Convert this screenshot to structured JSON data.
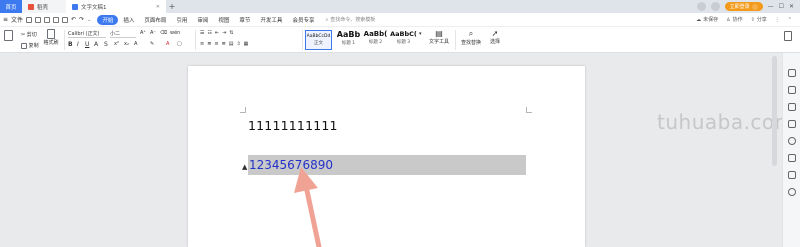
{
  "tabs": [
    {
      "label": "首页"
    },
    {
      "label": "稻壳"
    },
    {
      "label": "文字文稿1"
    }
  ],
  "tabbar_right": {
    "login": "立即登录"
  },
  "menubar": {
    "file": "文件",
    "items": [
      "开始",
      "插入",
      "页面布局",
      "引用",
      "审阅",
      "视图",
      "章节",
      "开发工具",
      "会员专享"
    ],
    "search_placeholder": "查找命令、搜索模板",
    "right": [
      "未保存",
      "协作",
      "分享"
    ]
  },
  "ribbon": {
    "cut": "剪切",
    "copy": "复制",
    "format_painter": "格式刷",
    "font_name": "Calibri (正文)",
    "font_size": "小二",
    "styles": [
      {
        "sample": "AaBbCcDd",
        "caption": "正文"
      },
      {
        "sample": "AaBb",
        "caption": "标题 1"
      },
      {
        "sample": "AaBb(",
        "caption": "标题 2"
      },
      {
        "sample": "AaBbC(",
        "caption": "标题 3"
      }
    ],
    "text_tool": "文字工具",
    "find_replace": "查找替换",
    "select": "选择"
  },
  "document": {
    "line1": "11111111111",
    "line2": "12345676890"
  },
  "watermark": "tuhuaba.com",
  "colors": {
    "accent": "#3d7af0",
    "login": "#f39a1b",
    "selected_text": "#2431c9",
    "selection_bg": "#c9c9c9",
    "arrow": "#f0a394"
  }
}
